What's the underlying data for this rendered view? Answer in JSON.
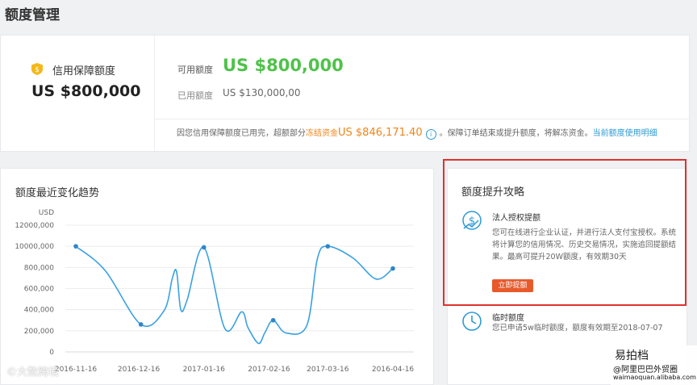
{
  "page": {
    "title": "额度管理"
  },
  "summary": {
    "guarantee_label": "信用保障额度",
    "guarantee_amount": "US $800,000",
    "available_label": "可用额度",
    "available_amount": "US $800,000",
    "used_label": "已用额度",
    "used_amount": "US $130,000,00",
    "notice_before": "因您信用保障额度已用完，超额部分",
    "notice_frozen": "冻结资金",
    "notice_amount": "US $846,171.40",
    "notice_info_glyph": "i",
    "notice_after": "。保障订单结束或提升额度，将解冻资金。",
    "notice_link": "当前额度使用明细"
  },
  "trend": {
    "title": "额度最近变化趋势"
  },
  "chart_data": {
    "type": "line",
    "title": "额度最近变化趋势",
    "ylabel": "USD",
    "ylim": [
      0,
      1200000
    ],
    "y_ticks": [
      "0",
      "200,000",
      "400,000",
      "600,000",
      "800,000",
      "10000,000",
      "12000,000"
    ],
    "y_tick_values": [
      0,
      200000,
      400000,
      600000,
      800000,
      1000000,
      1200000
    ],
    "x_ticks": [
      "2016-11-16",
      "2016-12-16",
      "2017-01-16",
      "2017-02-16",
      "2017-03-16",
      "2016-04-16"
    ],
    "x_tick_positions": [
      0,
      30,
      61,
      92,
      120,
      151
    ],
    "grid": true,
    "color": "#3aa1e3",
    "series": [
      {
        "name": "",
        "x": [
          0,
          14,
          31,
          42,
          46,
          48,
          50,
          53,
          61,
          71,
          79,
          82,
          87,
          90,
          94,
          100,
          110,
          115,
          120,
          132,
          143,
          151
        ],
        "y": [
          1000000,
          770000,
          260000,
          390000,
          700000,
          760000,
          400000,
          490000,
          990000,
          220000,
          380000,
          230000,
          80000,
          180000,
          300000,
          180000,
          250000,
          880000,
          1000000,
          890000,
          690000,
          790000
        ],
        "markers": [
          0,
          31,
          61,
          94,
          120,
          151
        ]
      }
    ]
  },
  "tips": {
    "title": "额度提升攻略",
    "icon_glyph": "$",
    "tip1_title": "法人授权提额",
    "tip1_desc": "您可在线进行企业认证，并进行法人支付宝授权。系统将计算您的信用情况、历史交易情况，实施追回提额结果。最高可提升20W额度，有效期30天",
    "tip1_button": "立即提额",
    "tip2_title": "临时额度",
    "tip2_desc": "您已申请5w临时额度，额度有效期至2018-07-07"
  },
  "watermarks": {
    "left": "©大数跨境",
    "right_brand": "易拍档",
    "right_line1": "@阿里巴巴外贸圈",
    "right_line2": "waimaoquan.alibaba.com"
  }
}
